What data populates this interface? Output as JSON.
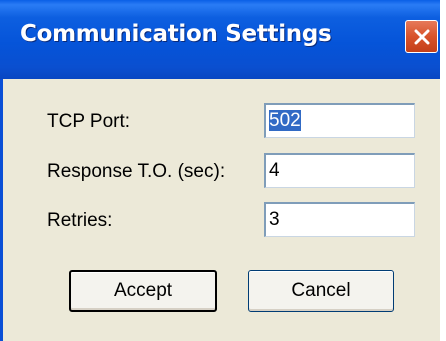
{
  "window": {
    "title": "Communication Settings"
  },
  "form": {
    "tcp_port": {
      "label": "TCP Port:",
      "value": "502"
    },
    "response_timeout": {
      "label": "Response T.O. (sec):",
      "value": "4"
    },
    "retries": {
      "label": "Retries:",
      "value": "3"
    }
  },
  "buttons": {
    "accept": "Accept",
    "cancel": "Cancel"
  },
  "icons": {
    "close": "close-icon"
  },
  "colors": {
    "titlebar": "#0554d9",
    "close_button": "#d8532b",
    "dialog_background": "#ece9d8",
    "selection": "#316ac5"
  }
}
